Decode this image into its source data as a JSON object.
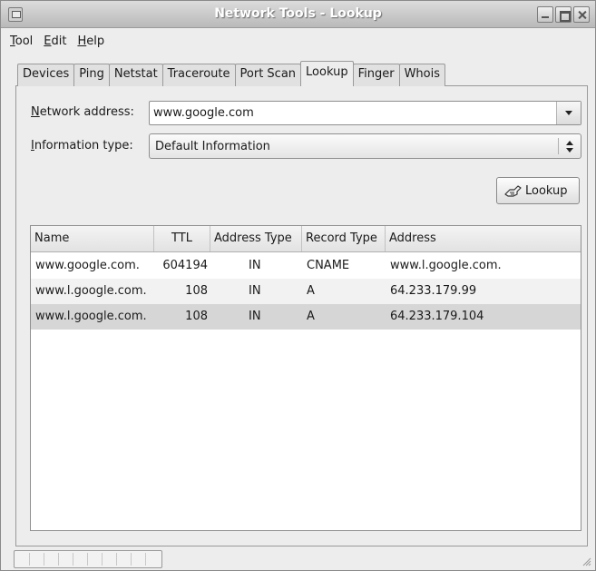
{
  "window": {
    "title": "Network Tools - Lookup"
  },
  "menu": {
    "items": [
      {
        "accel": "T",
        "rest": "ool"
      },
      {
        "accel": "E",
        "rest": "dit"
      },
      {
        "accel": "H",
        "rest": "elp"
      }
    ]
  },
  "tabs": [
    "Devices",
    "Ping",
    "Netstat",
    "Traceroute",
    "Port Scan",
    "Lookup",
    "Finger",
    "Whois"
  ],
  "active_tab": "Lookup",
  "form": {
    "address_label_accel": "N",
    "address_label_rest": "etwork address:",
    "address_value": "www.google.com",
    "info_label_accel": "I",
    "info_label_rest": "nformation type:",
    "info_value": "Default Information",
    "lookup_button": "Lookup"
  },
  "table": {
    "columns": [
      "Name",
      "TTL",
      "Address Type",
      "Record Type",
      "Address"
    ],
    "rows": [
      {
        "name": "www.google.com.",
        "ttl": "604194",
        "address_type": "IN",
        "record_type": "CNAME",
        "address": "www.l.google.com."
      },
      {
        "name": "www.l.google.com.",
        "ttl": "108",
        "address_type": "IN",
        "record_type": "A",
        "address": "64.233.179.99"
      },
      {
        "name": "www.l.google.com.",
        "ttl": "108",
        "address_type": "IN",
        "record_type": "A",
        "address": "64.233.179.104"
      }
    ],
    "selected_row": 3
  }
}
